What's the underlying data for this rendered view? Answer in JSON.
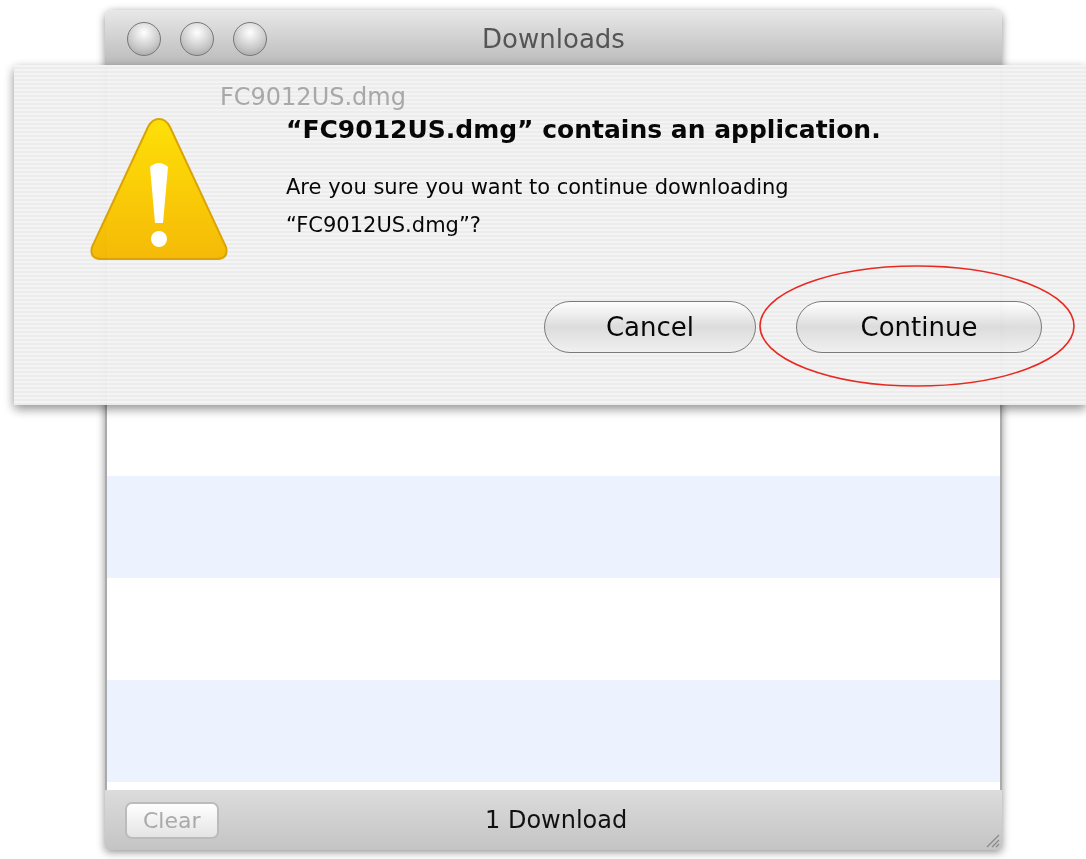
{
  "window": {
    "title": "Downloads"
  },
  "download_item": {
    "name": "FC9012US.dmg"
  },
  "alert": {
    "title": "“FC9012US.dmg” contains an application.",
    "message": "Are you sure you want to continue downloading “FC9012US.dmg”?",
    "buttons": [
      {
        "label": "Cancel",
        "circled": false
      },
      {
        "label": "Continue",
        "circled": true
      }
    ]
  },
  "status_bar": {
    "clear_button": {
      "label": "Clear",
      "disabled": true
    },
    "count": "1 Download"
  }
}
